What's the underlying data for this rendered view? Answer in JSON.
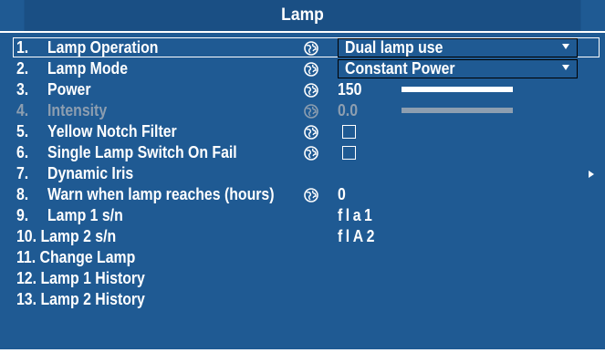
{
  "title": "Lamp",
  "colors": {
    "background": "#1f5a93",
    "title_bar": "#1a4f84",
    "text": "#ffffff",
    "disabled_text": "#8d9eb0",
    "slider_track": "#0d2540"
  },
  "items": [
    {
      "num": "1.",
      "label": "Lamp Operation",
      "globe_icon": "globe-icon",
      "control": "dropdown",
      "value": "Dual lamp use"
    },
    {
      "num": "2.",
      "label": "Lamp Mode",
      "globe_icon": "globe-icon",
      "control": "dropdown",
      "value": "Constant Power"
    },
    {
      "num": "3.",
      "label": "Power",
      "globe_icon": "globe-icon",
      "control": "slider",
      "value": "150",
      "slider_fraction": 1.0
    },
    {
      "num": "4.",
      "label": "Intensity",
      "globe_icon": "globe-icon",
      "control": "slider",
      "value": "0.0",
      "slider_fraction": 1.0,
      "disabled": true
    },
    {
      "num": "5.",
      "label": "Yellow Notch Filter",
      "globe_icon": "globe-icon",
      "control": "checkbox",
      "checked": false
    },
    {
      "num": "6.",
      "label": "Single Lamp Switch On Fail",
      "globe_icon": "globe-icon",
      "control": "checkbox",
      "checked": false
    },
    {
      "num": "7.",
      "label": "Dynamic Iris",
      "control": "submenu",
      "submenu_icon": "chevron-right-icon"
    },
    {
      "num": "8.",
      "label": "Warn when lamp reaches (hours)",
      "globe_icon": "globe-icon",
      "control": "text",
      "value": "0"
    },
    {
      "num": "9.",
      "label": "Lamp 1 s/n",
      "control": "text",
      "value": "fla1"
    },
    {
      "num": "10.",
      "label": "Lamp 2 s/n",
      "control": "text",
      "value": "flA2"
    },
    {
      "num": "11.",
      "label": "Change Lamp",
      "control": "none"
    },
    {
      "num": "12.",
      "label": "Lamp 1 History",
      "control": "none"
    },
    {
      "num": "13.",
      "label": "Lamp 2 History",
      "control": "none"
    }
  ]
}
